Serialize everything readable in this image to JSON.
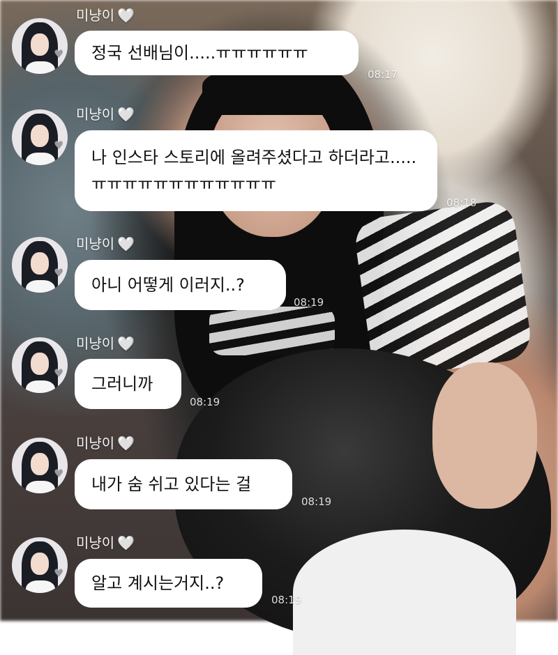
{
  "sender": {
    "name": "미냥이",
    "heart": "🤍",
    "avatar_icon": "profile-photo"
  },
  "messages": [
    {
      "text": "정국 선배님이.....ㅠㅠㅠㅠㅠㅠ",
      "time": "08:17"
    },
    {
      "text": "나 인스타 스토리에 올려주셨다고 하더라고.....ㅠㅠㅠㅠㅠㅠㅠㅠㅠㅠㅠㅠ",
      "time": "08:18"
    },
    {
      "text": "아니 어떻게 이러지..?",
      "time": "08:19"
    },
    {
      "text": "그러니까",
      "time": "08:19"
    },
    {
      "text": "내가 숨 쉬고 있다는 걸",
      "time": "08:19"
    },
    {
      "text": "알고 계시는거지..?",
      "time": "08:19"
    }
  ],
  "colors": {
    "bubble": "#ffffff",
    "name_text": "#f4f4f4"
  }
}
